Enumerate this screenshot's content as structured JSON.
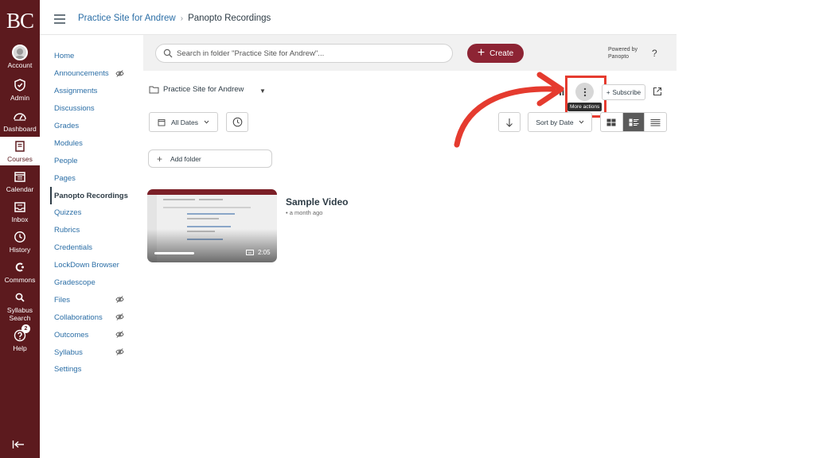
{
  "global_nav": {
    "logo": "BC",
    "items": [
      {
        "label": "Account",
        "icon": "avatar-icon"
      },
      {
        "label": "Admin",
        "icon": "shield-icon"
      },
      {
        "label": "Dashboard",
        "icon": "dashboard-icon"
      },
      {
        "label": "Courses",
        "icon": "book-icon",
        "active": true
      },
      {
        "label": "Calendar",
        "icon": "calendar-icon"
      },
      {
        "label": "Inbox",
        "icon": "inbox-icon"
      },
      {
        "label": "History",
        "icon": "clock-icon"
      },
      {
        "label": "Commons",
        "icon": "commons-icon"
      },
      {
        "label": "Syllabus",
        "label2": "Search",
        "icon": "search-icon"
      },
      {
        "label": "Help",
        "icon": "question-icon",
        "badge": "2"
      }
    ]
  },
  "breadcrumb": {
    "course": "Practice Site for Andrew",
    "separator": "›",
    "current": "Panopto Recordings"
  },
  "course_nav": {
    "items": [
      {
        "label": "Home"
      },
      {
        "label": "Announcements",
        "hidden": true
      },
      {
        "label": "Assignments"
      },
      {
        "label": "Discussions"
      },
      {
        "label": "Grades"
      },
      {
        "label": "Modules"
      },
      {
        "label": "People"
      },
      {
        "label": "Pages"
      },
      {
        "label": "Panopto Recordings",
        "active": true
      },
      {
        "label": "Quizzes"
      },
      {
        "label": "Rubrics"
      },
      {
        "label": "Credentials"
      },
      {
        "label": "LockDown Browser"
      },
      {
        "label": "Gradescope"
      },
      {
        "label": "Files",
        "hidden": true
      },
      {
        "label": "Collaborations",
        "hidden": true
      },
      {
        "label": "Outcomes",
        "hidden": true
      },
      {
        "label": "Syllabus",
        "hidden": true
      },
      {
        "label": "Settings"
      }
    ]
  },
  "panopto": {
    "search_placeholder": "Search in folder \"Practice Site for Andrew\"...",
    "create_label": "Create",
    "powered_line1": "Powered by",
    "powered_line2": "Panopto",
    "help_label": "?",
    "folder_name": "Practice Site for Andrew",
    "more_actions_tooltip": "More actions",
    "subscribe_label": "Subscribe",
    "date_filter": "All Dates",
    "sort_label": "Sort by Date",
    "add_folder_label": "Add folder",
    "colors": {
      "create": "#8d2434",
      "highlight": "#e53b2f",
      "nav": "#5c1a1e"
    }
  },
  "video": {
    "title": "Sample Video",
    "meta": "• a month ago",
    "duration": "2:05"
  }
}
